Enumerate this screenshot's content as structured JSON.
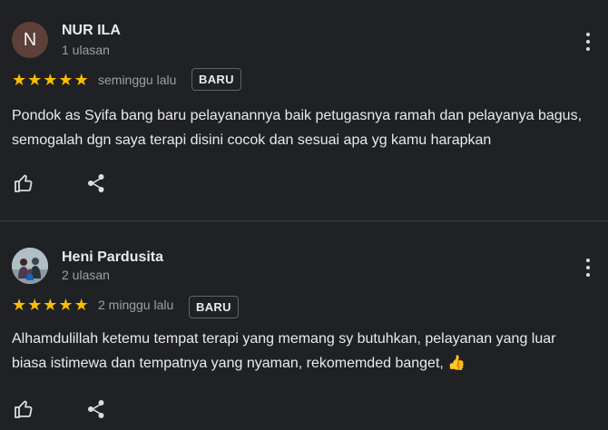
{
  "reviews": [
    {
      "avatar_letter": "N",
      "name": "NUR ILA",
      "review_count": "1 ulasan",
      "rating": 5,
      "time": "seminggu lalu",
      "badge": "BARU",
      "text": "Pondok as Syifa bang baru pelayanannya baik petugasnya ramah dan pelayanya bagus, semogalah dgn saya terapi disini cocok dan sesuai apa yg kamu harapkan"
    },
    {
      "avatar_letter": "",
      "name": "Heni Pardusita",
      "review_count": "2 ulasan",
      "rating": 5,
      "time": "2 minggu lalu",
      "badge": "BARU",
      "text": "Alhamdulillah ketemu tempat terapi yang memang sy butuhkan, pelayanan yang luar biasa istimewa dan tempatnya yang nyaman, rekomemded banget, 👍"
    }
  ],
  "icons": {
    "like": "thumbs-up-icon",
    "share": "share-icon",
    "more": "more-vertical-icon",
    "star": "star-icon"
  },
  "colors": {
    "background": "#202124",
    "star": "#fbbc04",
    "text": "#e8eaed",
    "secondary_text": "#9aa0a6"
  }
}
